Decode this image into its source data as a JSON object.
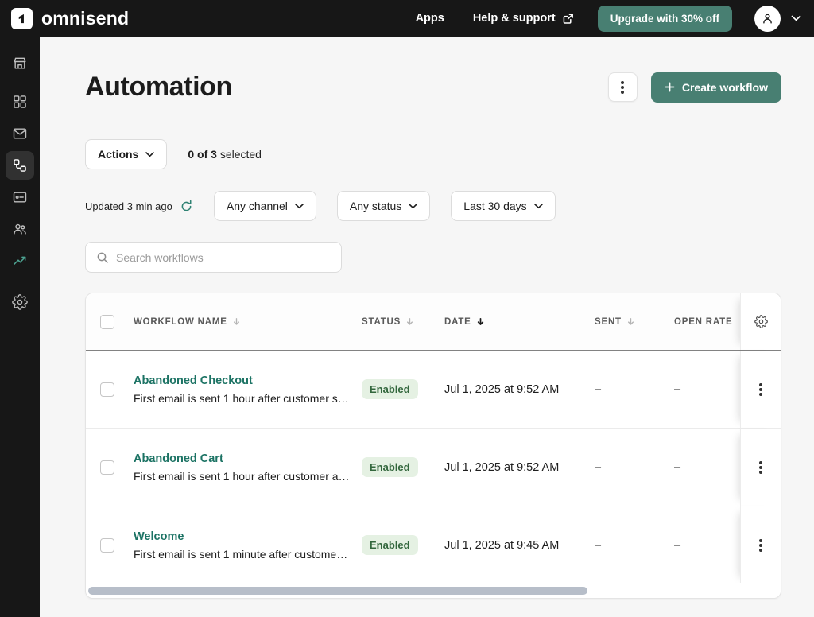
{
  "topbar": {
    "brand": "omnisend",
    "apps_label": "Apps",
    "help_label": "Help & support",
    "upgrade_label": "Upgrade with 30% off"
  },
  "sidebar": {
    "items": [
      {
        "icon": "store-icon",
        "active": false
      },
      {
        "icon": "dashboard-icon",
        "active": false
      },
      {
        "icon": "email-icon",
        "active": false
      },
      {
        "icon": "automation-icon",
        "active": true
      },
      {
        "icon": "forms-icon",
        "active": false
      },
      {
        "icon": "audience-icon",
        "active": false
      },
      {
        "icon": "reports-icon",
        "active": false
      },
      {
        "icon": "settings-icon",
        "active": false
      }
    ]
  },
  "page": {
    "title": "Automation",
    "create_label": "Create workflow",
    "actions_label": "Actions",
    "selected_count": "0 of 3",
    "selected_suffix": "selected",
    "updated_text": "Updated 3 min ago",
    "filters": [
      {
        "label": "Any channel"
      },
      {
        "label": "Any status"
      },
      {
        "label": "Last 30 days"
      }
    ],
    "search_placeholder": "Search workflows"
  },
  "table": {
    "columns": [
      {
        "label": "WORKFLOW NAME",
        "sort": "inactive"
      },
      {
        "label": "STATUS",
        "sort": "inactive"
      },
      {
        "label": "DATE",
        "sort": "active-desc"
      },
      {
        "label": "SENT",
        "sort": "inactive"
      },
      {
        "label": "OPEN RATE",
        "sort": "none"
      }
    ],
    "rows": [
      {
        "name": "Abandoned Checkout",
        "description": "First email is sent 1 hour after customer s…",
        "status": "Enabled",
        "date": "Jul 1, 2025 at 9:52 AM",
        "sent": "–",
        "open_rate": "–"
      },
      {
        "name": "Abandoned Cart",
        "description": "First email is sent 1 hour after customer a…",
        "status": "Enabled",
        "date": "Jul 1, 2025 at 9:52 AM",
        "sent": "–",
        "open_rate": "–"
      },
      {
        "name": "Welcome",
        "description": "First email is sent 1 minute after custome…",
        "status": "Enabled",
        "date": "Jul 1, 2025 at 9:45 AM",
        "sent": "–",
        "open_rate": "–"
      }
    ]
  },
  "colors": {
    "accent_teal": "#487f72",
    "link_teal": "#1c7364",
    "badge_bg": "#e5f1e3",
    "badge_text": "#33673d",
    "topbar_bg": "#171717",
    "sidebar_active_bg": "#313131",
    "reports_icon_teal": "#4da392",
    "scrollbar_thumb": "#b7bec9"
  }
}
